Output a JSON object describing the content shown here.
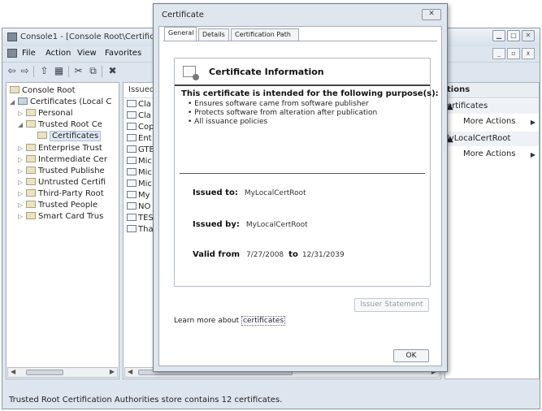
{
  "mmc": {
    "title": "Console1 - [Console Root\\Certific",
    "menu": [
      "File",
      "Action",
      "View",
      "Favorites"
    ],
    "tree": {
      "items": [
        {
          "label": "Console Root",
          "expander": ""
        },
        {
          "label": "Certificates (Local C",
          "expander": "◢"
        },
        {
          "label": "Personal",
          "expander": "▷"
        },
        {
          "label": "Trusted Root Ce",
          "expander": "◢"
        },
        {
          "label": "Certificates",
          "expander": ""
        },
        {
          "label": "Enterprise Trust",
          "expander": "▷"
        },
        {
          "label": "Intermediate Cer",
          "expander": "▷"
        },
        {
          "label": "Trusted Publishe",
          "expander": "▷"
        },
        {
          "label": "Untrusted Certifi",
          "expander": "▷"
        },
        {
          "label": "Third-Party Root",
          "expander": "▷"
        },
        {
          "label": "Trusted People",
          "expander": "▷"
        },
        {
          "label": "Smart Card Trus",
          "expander": "▷"
        }
      ]
    },
    "list": {
      "header": "Issued",
      "rows": [
        "Cla",
        "Cla",
        "Cop",
        "Ent",
        "GTE",
        "Mic",
        "Mic",
        "Mic",
        "My",
        "NO",
        "TES",
        "Tha"
      ]
    },
    "actions": {
      "header": "tions",
      "section1": "ertificates",
      "section1_item": "More Actions",
      "section2": "lyLocalCertRoot",
      "section2_item": "More Actions"
    },
    "status": "Trusted Root Certification Authorities store contains 12 certificates."
  },
  "dialog": {
    "title": "Certificate",
    "close": "✕",
    "tabs": [
      "General",
      "Details",
      "Certification Path"
    ],
    "heading": "Certificate Information",
    "purpose_title": "This certificate is intended for the following purpose(s):",
    "purposes": [
      "• Ensures software came from software publisher",
      "• Protects software from alteration after publication",
      "• All issuance policies"
    ],
    "issued_to_label": "Issued to:",
    "issued_to": "MyLocalCertRoot",
    "issued_by_label": "Issued by:",
    "issued_by": "MyLocalCertRoot",
    "valid_from_label": "Valid from",
    "valid_from": "7/27/2008",
    "valid_to_label": "to",
    "valid_to": "12/31/2039",
    "issuer_statement": "Issuer Statement",
    "learn_more_prefix": "Learn more about",
    "learn_more_link": "certificates",
    "ok": "OK"
  }
}
